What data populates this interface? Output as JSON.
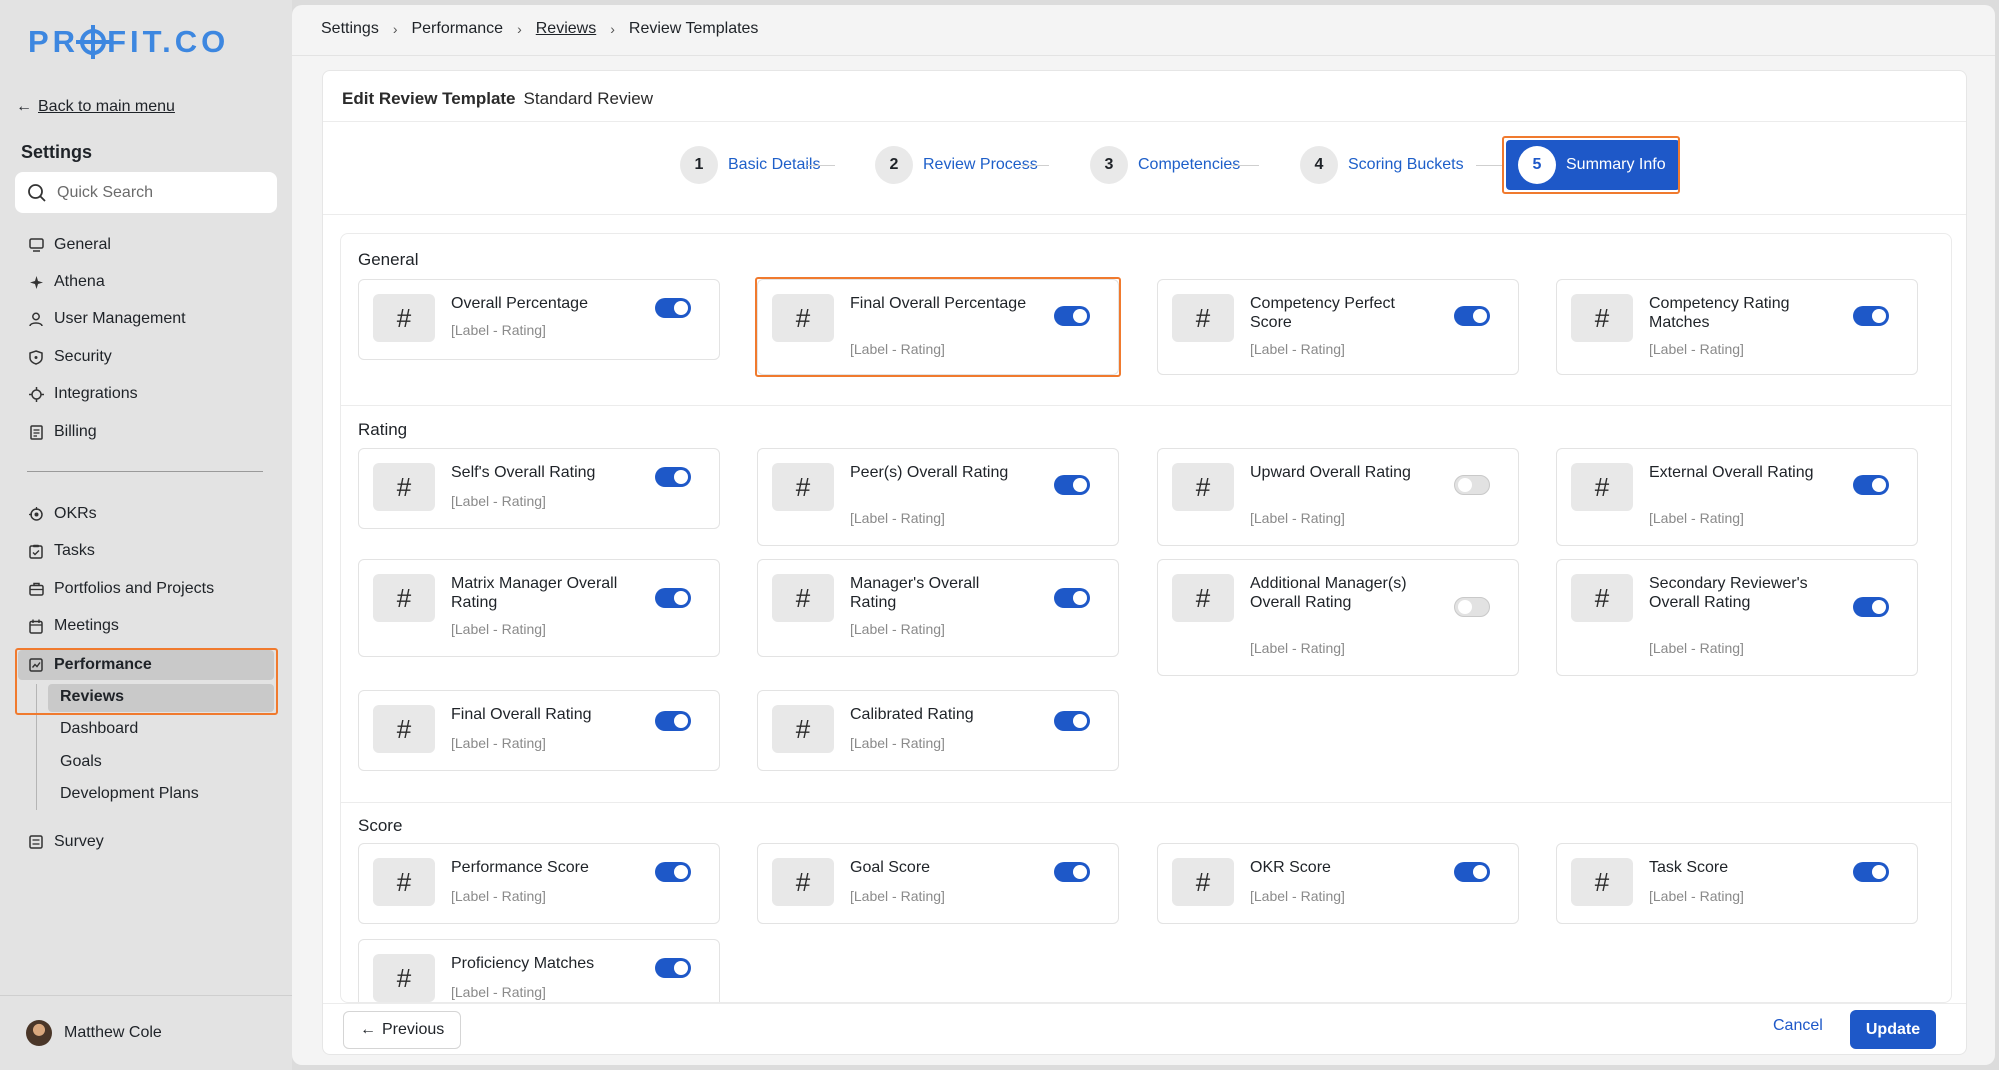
{
  "sidebar": {
    "logo": [
      "PR",
      "FIT.CO"
    ],
    "back_label": "Back to main menu",
    "settings_title": "Settings",
    "search_placeholder": "Quick Search",
    "items": [
      {
        "label": "General",
        "icon": "monitor-icon"
      },
      {
        "label": "Athena",
        "icon": "sparkle-icon"
      },
      {
        "label": "User Management",
        "icon": "user-icon"
      },
      {
        "label": "Security",
        "icon": "shield-icon"
      },
      {
        "label": "Integrations",
        "icon": "plug-icon"
      },
      {
        "label": "Billing",
        "icon": "receipt-icon"
      },
      {
        "label": "OKRs",
        "icon": "target-icon"
      },
      {
        "label": "Tasks",
        "icon": "clipboard-check-icon"
      },
      {
        "label": "Portfolios and Projects",
        "icon": "briefcase-icon"
      },
      {
        "label": "Meetings",
        "icon": "calendar-icon"
      },
      {
        "label": "Performance",
        "icon": "chart-icon"
      },
      {
        "label": "Survey",
        "icon": "list-icon"
      }
    ],
    "performance_sub": [
      "Reviews",
      "Dashboard",
      "Goals",
      "Development Plans"
    ],
    "user_name": "Matthew Cole"
  },
  "breadcrumb": [
    "Settings",
    "Performance",
    "Reviews",
    "Review Templates"
  ],
  "card": {
    "title": "Edit Review Template",
    "subtitle": "Standard Review"
  },
  "steps": [
    {
      "num": "1",
      "label": "Basic Details"
    },
    {
      "num": "2",
      "label": "Review Process"
    },
    {
      "num": "3",
      "label": "Competencies"
    },
    {
      "num": "4",
      "label": "Scoring Buckets"
    },
    {
      "num": "5",
      "label": "Summary Info"
    }
  ],
  "sections": {
    "general": "General",
    "rating": "Rating",
    "score": "Score"
  },
  "tile_sub": "[Label - Rating]",
  "tiles": {
    "general": [
      {
        "name": "Overall Percentage",
        "on": true
      },
      {
        "name": "Final Overall Percentage",
        "on": true
      },
      {
        "name": "Competency Perfect Score",
        "on": true
      },
      {
        "name": "Competency Rating Matches",
        "on": true
      }
    ],
    "rating": [
      {
        "name": "Self's Overall Rating",
        "on": true
      },
      {
        "name": "Peer(s) Overall Rating",
        "on": true
      },
      {
        "name": "Upward Overall Rating",
        "on": false
      },
      {
        "name": "External Overall Rating",
        "on": true
      },
      {
        "name": "Matrix Manager Overall Rating",
        "on": true
      },
      {
        "name": "Manager's Overall Rating",
        "on": true
      },
      {
        "name": "Additional Manager(s) Overall Rating",
        "on": false
      },
      {
        "name": "Secondary Reviewer's Overall Rating",
        "on": true
      },
      {
        "name": "Final Overall Rating",
        "on": true
      },
      {
        "name": "Calibrated Rating",
        "on": true
      }
    ],
    "score": [
      {
        "name": "Performance Score",
        "on": true
      },
      {
        "name": "Goal Score",
        "on": true
      },
      {
        "name": "OKR Score",
        "on": true
      },
      {
        "name": "Task Score",
        "on": true
      },
      {
        "name": "Proficiency Matches",
        "on": true
      }
    ]
  },
  "footer": {
    "previous": "Previous",
    "cancel": "Cancel",
    "update": "Update"
  }
}
